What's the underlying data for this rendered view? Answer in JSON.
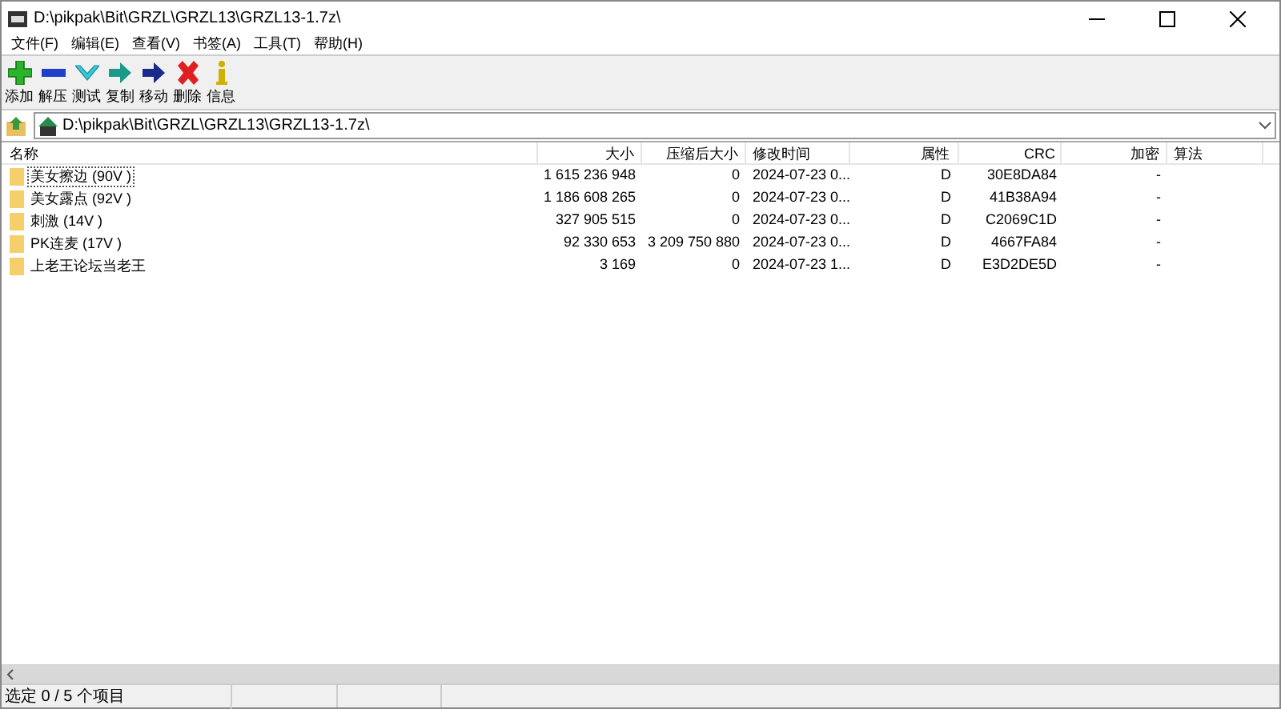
{
  "window": {
    "title": "D:\\pikpak\\Bit\\GRZL\\GRZL13\\GRZL13-1.7z\\"
  },
  "menu": [
    "文件(F)",
    "编辑(E)",
    "查看(V)",
    "书签(A)",
    "工具(T)",
    "帮助(H)"
  ],
  "toolbar": [
    {
      "kind": "add",
      "label": "添加"
    },
    {
      "kind": "extract",
      "label": "解压"
    },
    {
      "kind": "test",
      "label": "测试"
    },
    {
      "kind": "copy",
      "label": "复制"
    },
    {
      "kind": "move",
      "label": "移动"
    },
    {
      "kind": "delete",
      "label": "删除"
    },
    {
      "kind": "info",
      "label": "信息"
    }
  ],
  "address": {
    "value": "D:\\pikpak\\Bit\\GRZL\\GRZL13\\GRZL13-1.7z\\"
  },
  "table": {
    "columns": [
      "名称",
      "大小",
      "压缩后大小",
      "修改时间",
      "属性",
      "CRC",
      "加密",
      "算法"
    ],
    "rows": [
      {
        "focused": true,
        "cells": [
          "美女擦边 (90V )",
          "1 615 236 948",
          "0",
          "2024-07-23 0...",
          "D",
          "30E8DA84",
          "-"
        ]
      },
      {
        "focused": false,
        "cells": [
          "美女露点 (92V )",
          "1 186 608 265",
          "0",
          "2024-07-23 0...",
          "D",
          "41B38A94",
          "-"
        ]
      },
      {
        "focused": false,
        "cells": [
          "刺激 (14V )",
          "327 905 515",
          "0",
          "2024-07-23 0...",
          "D",
          "C2069C1D",
          "-"
        ]
      },
      {
        "focused": false,
        "cells": [
          "PK连麦 (17V )",
          "92 330 653",
          "3 209 750 880",
          "2024-07-23 0...",
          "D",
          "4667FA84",
          "-"
        ]
      },
      {
        "focused": false,
        "cells": [
          "上老王论坛当老王",
          "3 169",
          "0",
          "2024-07-23 1...",
          "D",
          "E3D2DE5D",
          "-"
        ]
      }
    ]
  },
  "status_bar": {
    "text": "选定 0 / 5 个项目"
  }
}
